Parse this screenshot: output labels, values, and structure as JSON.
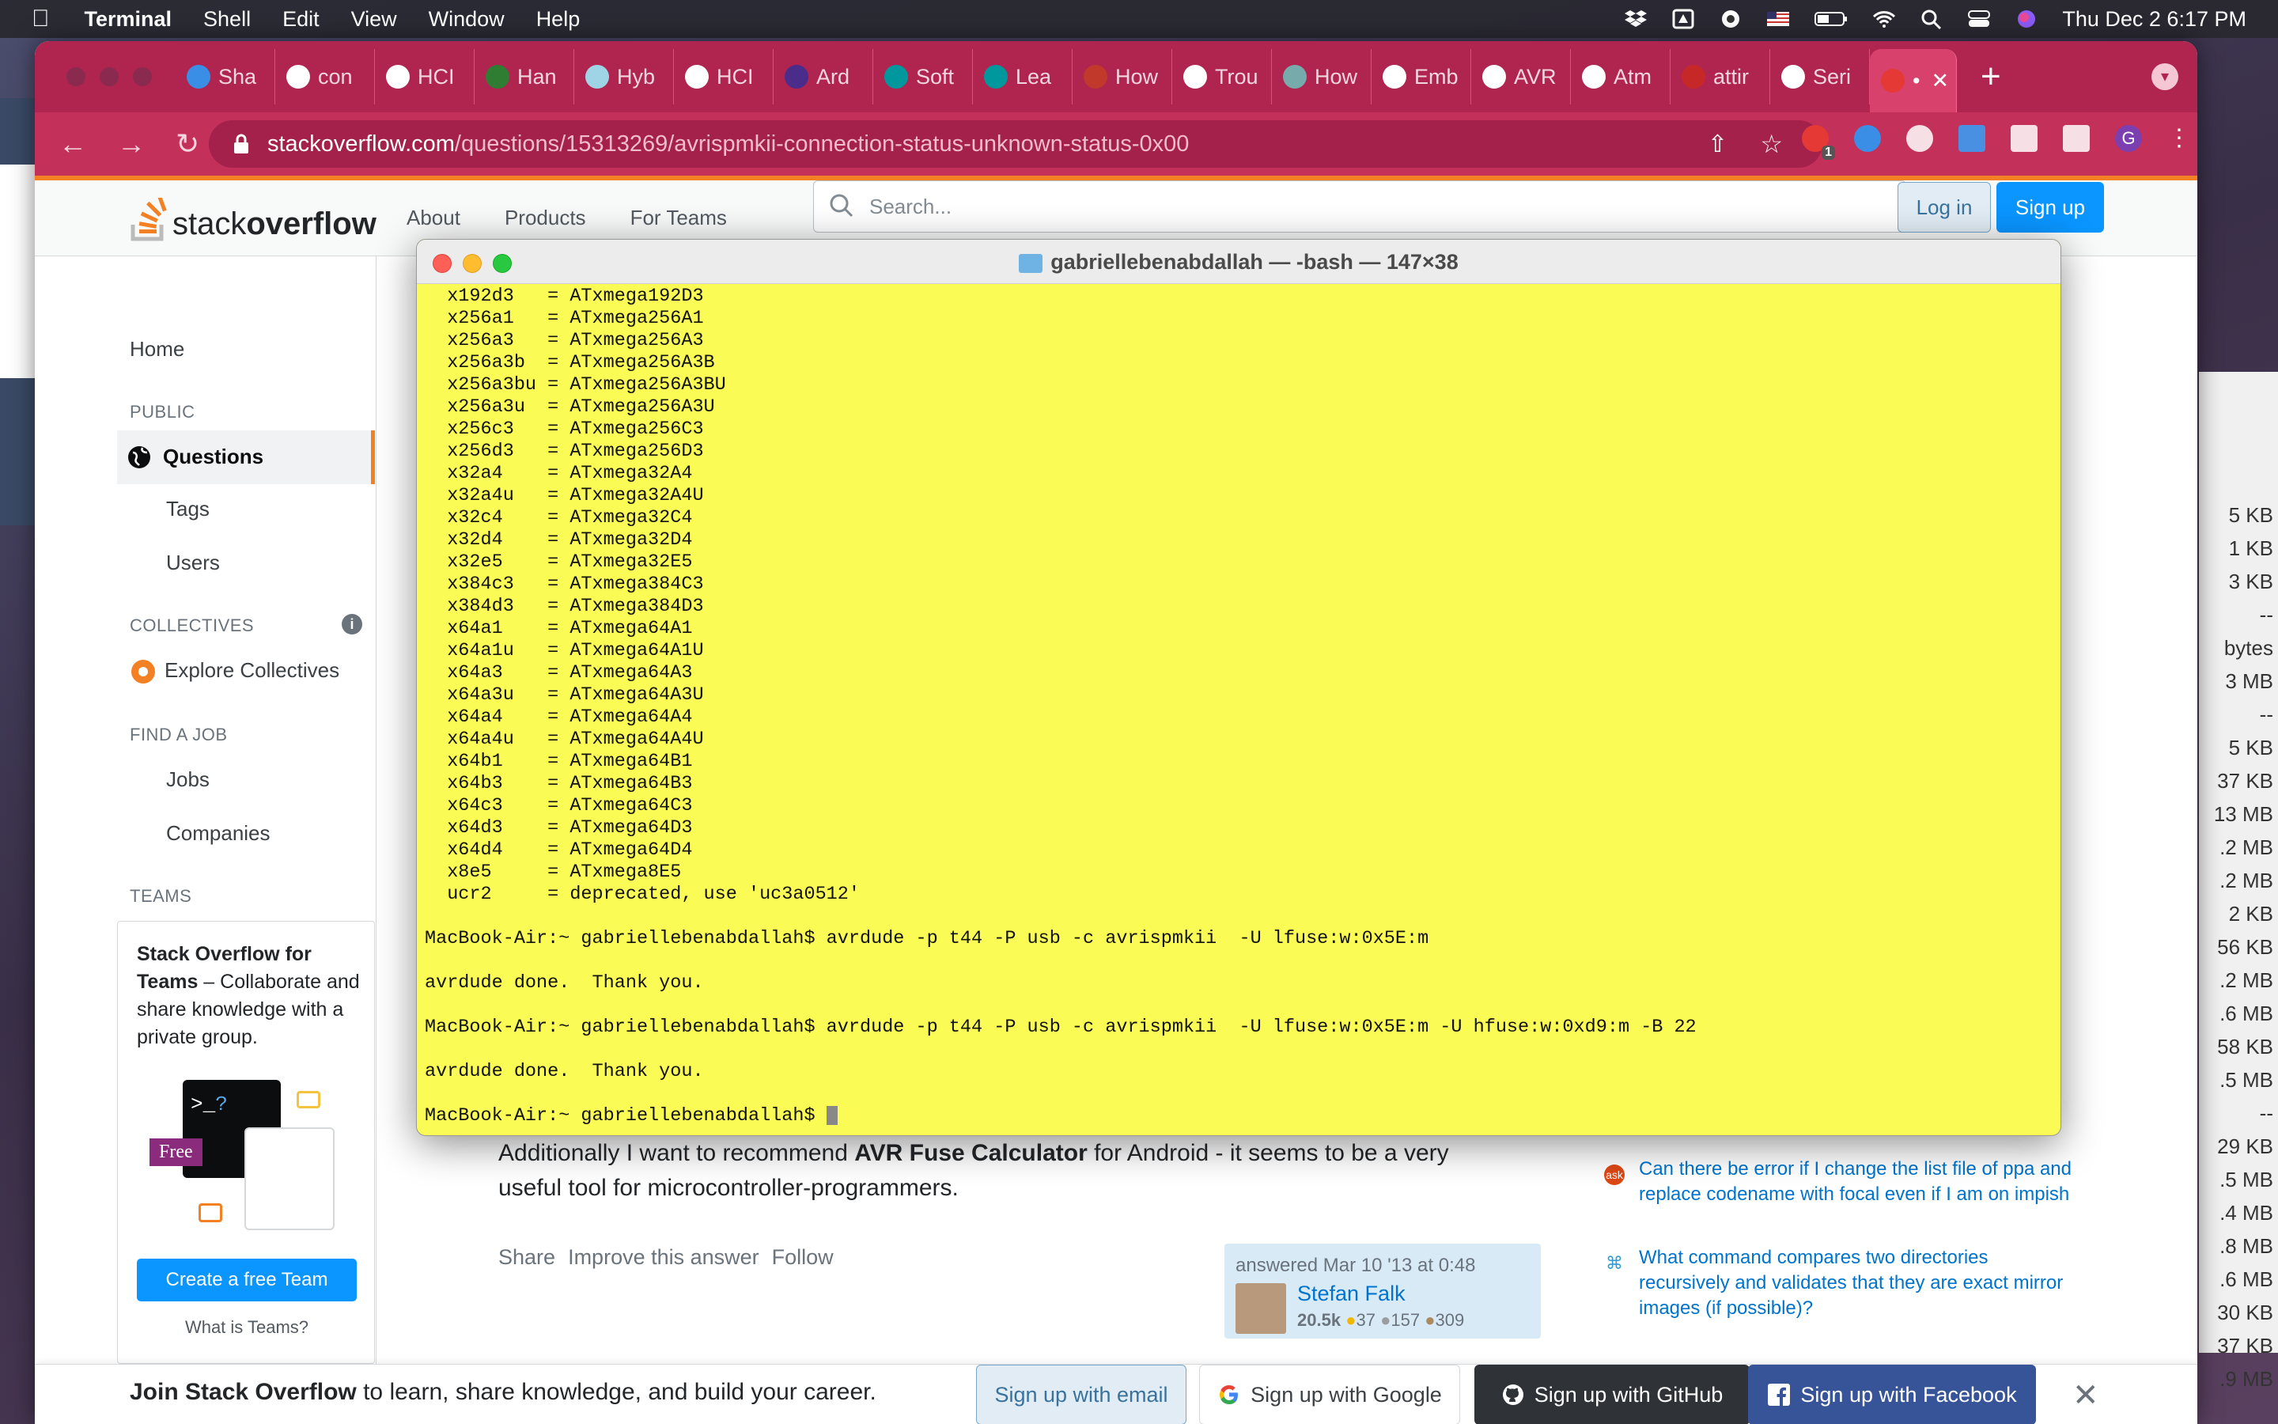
{
  "menubar": {
    "app": "Terminal",
    "items": [
      "Shell",
      "Edit",
      "View",
      "Window",
      "Help"
    ],
    "datetime": "Thu Dec 2  6:17 PM"
  },
  "browser": {
    "tabs": [
      "Sha",
      "con",
      "HCI",
      "Han",
      "Hyb",
      "HCI",
      "Ard",
      "Soft",
      "Lea",
      "How",
      "Trou",
      "How",
      "Emb",
      "AVR",
      "Atm",
      "attir",
      "Seri",
      "•"
    ],
    "url_host": "stackoverflow.com",
    "url_path": "/questions/15313269/avrispmkii-connection-status-unknown-status-0x00",
    "ext_badge": "1",
    "profile_initial": "G"
  },
  "so": {
    "logo_light": "stack",
    "logo_bold": "overflow",
    "nav": [
      "About",
      "Products",
      "For Teams"
    ],
    "search_placeholder": "Search...",
    "login": "Log in",
    "signup": "Sign up",
    "sidebar": {
      "home": "Home",
      "public": "PUBLIC",
      "questions": "Questions",
      "tags": "Tags",
      "users": "Users",
      "collectives": "COLLECTIVES",
      "explore": "Explore Collectives",
      "find_job": "FIND A JOB",
      "jobs": "Jobs",
      "companies": "Companies",
      "teams": "TEAMS",
      "teams_title": "Stack Overflow for Teams",
      "teams_desc": " – Collaborate and share knowledge with a private group.",
      "free": "Free",
      "create_team": "Create a free Team",
      "what_teams": "What is Teams?"
    },
    "answer": {
      "line1_pre": "Additionally I want to recommend ",
      "line1_bold": "AVR Fuse Calculator",
      "line1_post": " for Android - it seems to be a very",
      "line2": "useful tool for microcontroller-programmers.",
      "share": "Share",
      "improve": "Improve this answer",
      "follow": "Follow",
      "answered": "answered Mar 10 '13 at 0:48",
      "user": "Stefan Falk",
      "rep": "20.5k",
      "gold": "37",
      "silver": "157",
      "bronze": "309"
    },
    "related": [
      "Can there be error if I change the list file of ppa and replace codename with focal even if I am on impish",
      "What command compares two directories recursively and validates that they are exact mirror images (if possible)?"
    ],
    "banner": {
      "bold": "Join Stack Overflow",
      "rest": " to learn, share knowledge, and build your career.",
      "email": "Sign up with email",
      "google": "Sign up with Google",
      "github": "Sign up with GitHub",
      "facebook": "Sign up with Facebook"
    }
  },
  "terminal": {
    "title": "gabriellebenabdallah — -bash — 147×38",
    "lines": [
      "  x192d3   = ATxmega192D3",
      "  x256a1   = ATxmega256A1",
      "  x256a3   = ATxmega256A3",
      "  x256a3b  = ATxmega256A3B",
      "  x256a3bu = ATxmega256A3BU",
      "  x256a3u  = ATxmega256A3U",
      "  x256c3   = ATxmega256C3",
      "  x256d3   = ATxmega256D3",
      "  x32a4    = ATxmega32A4",
      "  x32a4u   = ATxmega32A4U",
      "  x32c4    = ATxmega32C4",
      "  x32d4    = ATxmega32D4",
      "  x32e5    = ATxmega32E5",
      "  x384c3   = ATxmega384C3",
      "  x384d3   = ATxmega384D3",
      "  x64a1    = ATxmega64A1",
      "  x64a1u   = ATxmega64A1U",
      "  x64a3    = ATxmega64A3",
      "  x64a3u   = ATxmega64A3U",
      "  x64a4    = ATxmega64A4",
      "  x64a4u   = ATxmega64A4U",
      "  x64b1    = ATxmega64B1",
      "  x64b3    = ATxmega64B3",
      "  x64c3    = ATxmega64C3",
      "  x64d3    = ATxmega64D3",
      "  x64d4    = ATxmega64D4",
      "  x8e5     = ATxmega8E5",
      "  ucr2     = deprecated, use 'uc3a0512'",
      "",
      "MacBook-Air:~ gabriellebenabdallah$ avrdude -p t44 -P usb -c avrispmkii  -U lfuse:w:0x5E:m",
      "",
      "avrdude done.  Thank you.",
      "",
      "MacBook-Air:~ gabriellebenabdallah$ avrdude -p t44 -P usb -c avrispmkii  -U lfuse:w:0x5E:m -U hfuse:w:0xd9:m -B 22",
      "",
      "avrdude done.  Thank you.",
      ""
    ],
    "prompt": "MacBook-Air:~ gabriellebenabdallah$ "
  },
  "finder_sizes": [
    "5 KB",
    "1 KB",
    "3 KB",
    "--",
    "bytes",
    "3 MB",
    "--",
    "5 KB",
    "37 KB",
    "13 MB",
    ".2 MB",
    ".2 MB",
    "2 KB",
    "56 KB",
    ".2 MB",
    ".6 MB",
    "58 KB",
    ".5 MB",
    "--",
    "29 KB",
    ".5 MB",
    ".4 MB",
    ".8 MB",
    ".6 MB",
    "30 KB",
    "37 KB",
    ".9 MB"
  ]
}
